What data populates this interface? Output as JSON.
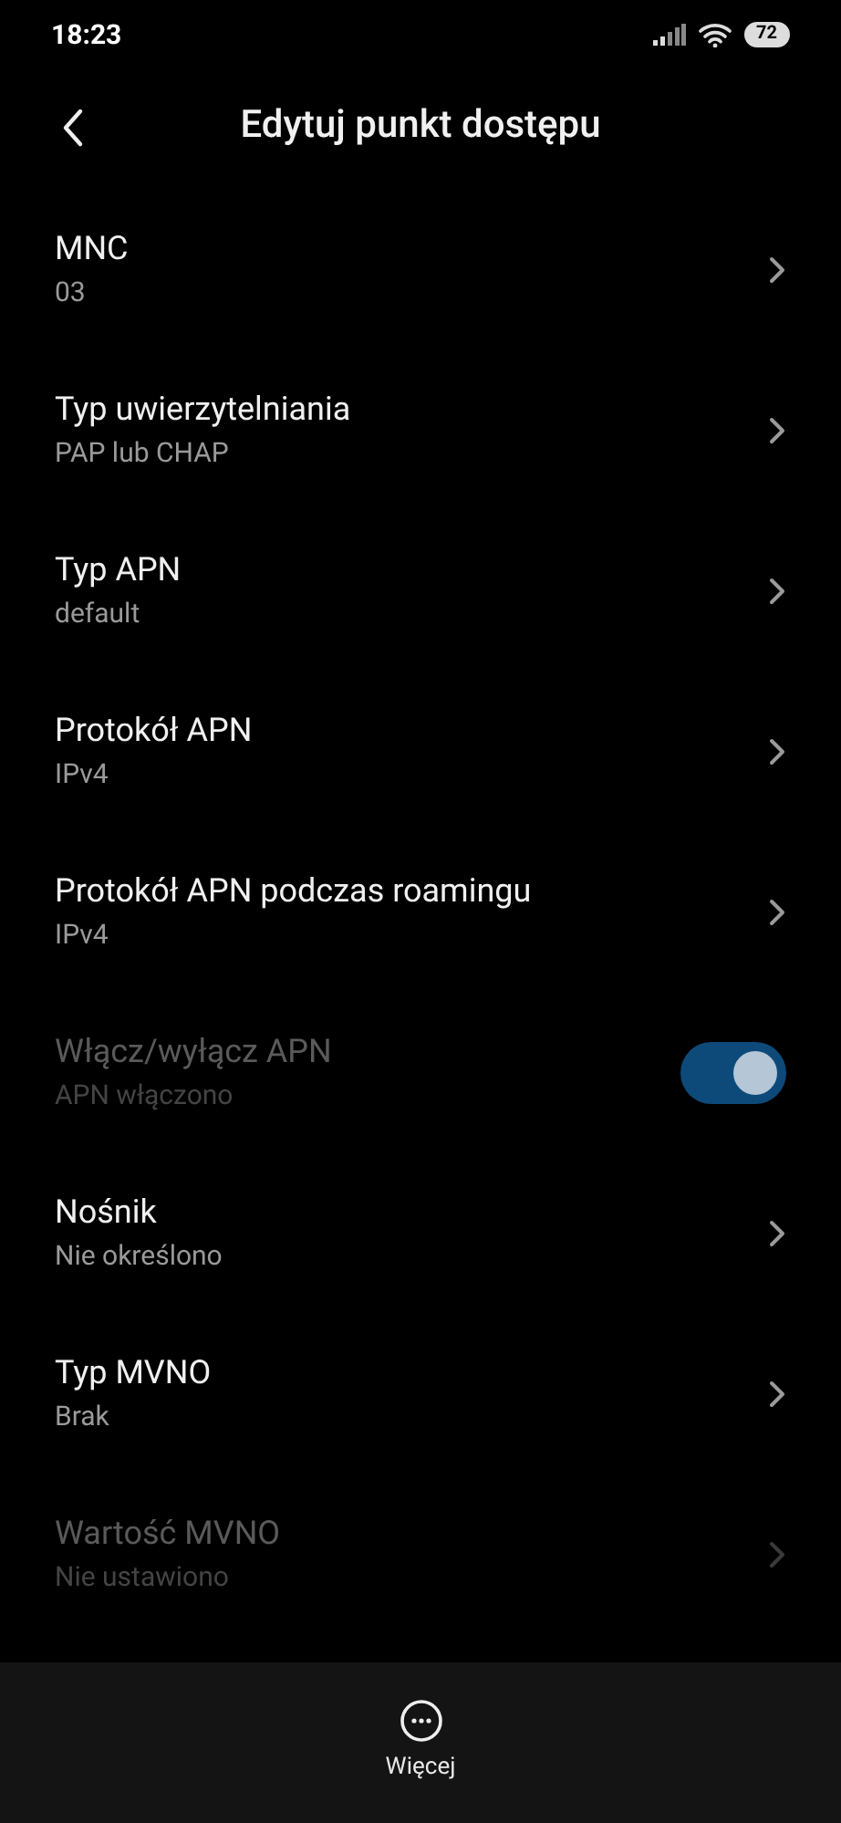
{
  "status_bar": {
    "time": "18:23",
    "battery": "72"
  },
  "header": {
    "title": "Edytuj punkt dostępu"
  },
  "items": [
    {
      "kind": "link",
      "title": "MNC",
      "value": "03",
      "disabled": false
    },
    {
      "kind": "link",
      "title": "Typ uwierzytelniania",
      "value": "PAP lub CHAP",
      "disabled": false
    },
    {
      "kind": "link",
      "title": "Typ APN",
      "value": "default",
      "disabled": false
    },
    {
      "kind": "link",
      "title": "Protokół APN",
      "value": "IPv4",
      "disabled": false
    },
    {
      "kind": "link",
      "title": "Protokół APN podczas roamingu",
      "value": "IPv4",
      "disabled": false
    },
    {
      "kind": "switch",
      "title": "Włącz/wyłącz APN",
      "value": "APN włączono",
      "disabled": true,
      "on": true
    },
    {
      "kind": "link",
      "title": "Nośnik",
      "value": "Nie określono",
      "disabled": false
    },
    {
      "kind": "link",
      "title": "Typ MVNO",
      "value": "Brak",
      "disabled": false
    },
    {
      "kind": "link",
      "title": "Wartość MVNO",
      "value": "Nie ustawiono",
      "disabled": true
    }
  ],
  "bottom_bar": {
    "label": "Więcej"
  }
}
